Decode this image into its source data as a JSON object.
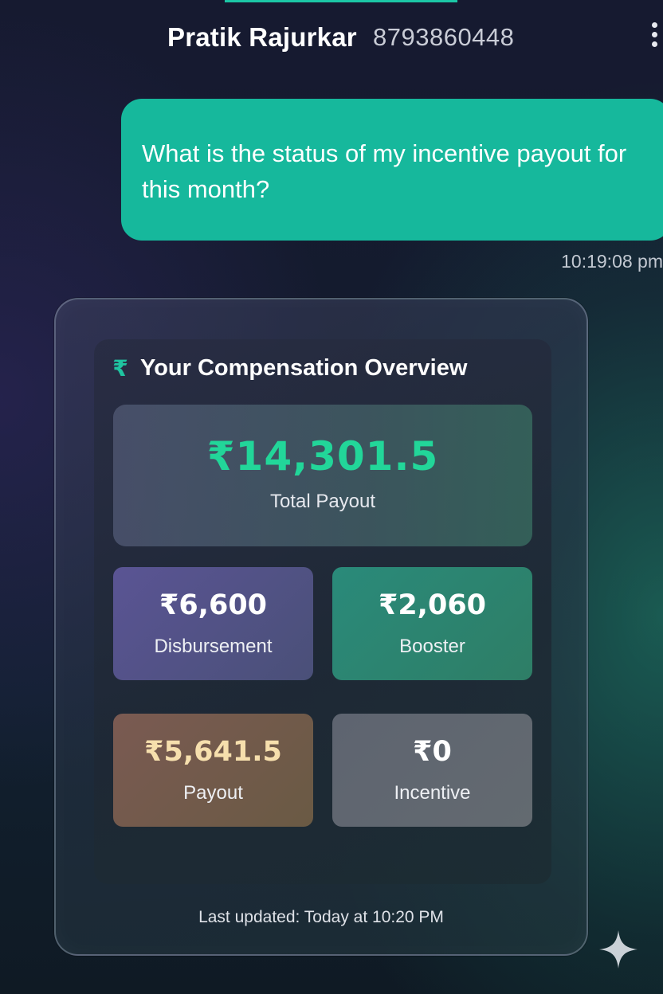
{
  "header": {
    "contact_name": "Pratik Rajurkar",
    "contact_phone": "8793860448",
    "menu_icon": "more-vertical-icon"
  },
  "message": {
    "text": "What is the status of my incentive payout for this month?",
    "timestamp": "10:19:08 pm"
  },
  "compensation_card": {
    "title_icon": "₹",
    "title": "Your Compensation Overview",
    "total": {
      "value": "₹14,301.5",
      "label": "Total Payout"
    },
    "stats": [
      {
        "value": "₹6,600",
        "label": "Disbursement"
      },
      {
        "value": "₹2,060",
        "label": "Booster"
      },
      {
        "value": "₹5,641.5",
        "label": "Payout"
      },
      {
        "value": "₹0",
        "label": "Incentive"
      }
    ],
    "last_updated": "Last updated: Today at 10:20 PM"
  },
  "colors": {
    "accent_teal": "#16b89c",
    "total_green": "#22d699",
    "payout_value": "#f6dfad"
  },
  "watermark_icon": "sparkle-icon"
}
